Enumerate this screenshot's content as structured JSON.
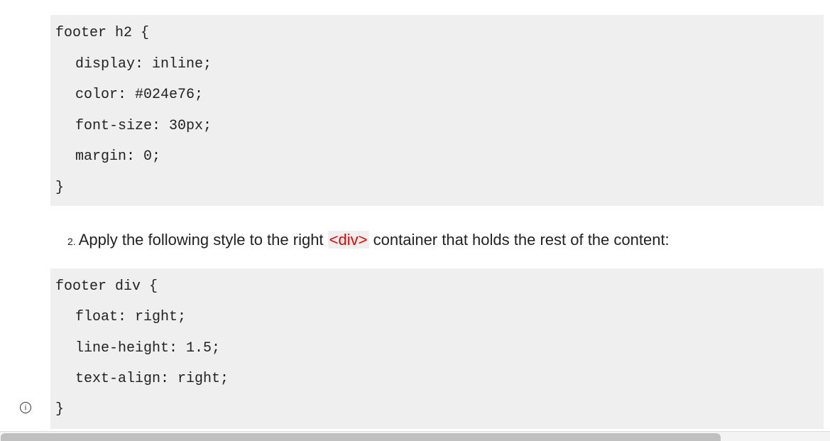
{
  "code_block_1": {
    "lines": [
      "footer h2 {",
      "display: inline;",
      "color: #024e76;",
      "font-size: 30px;",
      "margin: 0;",
      "}"
    ]
  },
  "step_2": {
    "number": "2.",
    "text_before": "Apply the following style to the right",
    "tag": "<div>",
    "text_after": "container that holds the rest of the content:"
  },
  "code_block_2": {
    "lines": [
      "footer div {",
      "float: right;",
      "line-height: 1.5;",
      "text-align: right;",
      "}"
    ]
  },
  "info_icon": "i"
}
